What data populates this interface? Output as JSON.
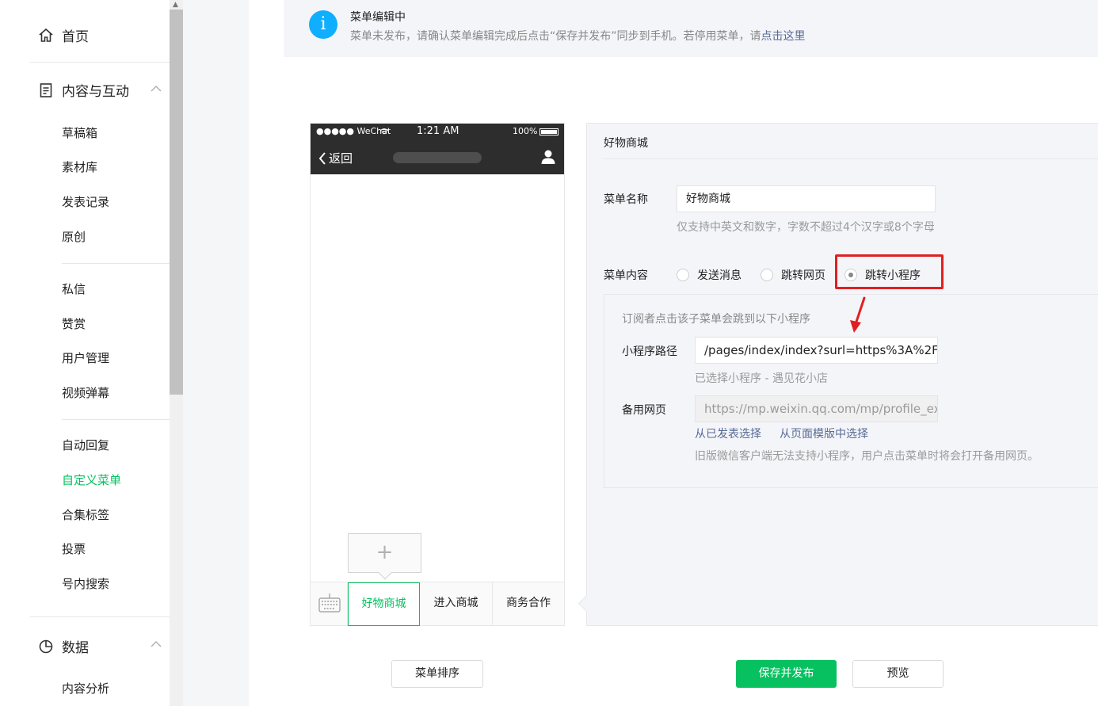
{
  "sidebar": {
    "home": "首页",
    "content_section": "内容与互动",
    "items_group1": [
      "草稿箱",
      "素材库",
      "发表记录",
      "原创"
    ],
    "items_group2": [
      "私信",
      "赞赏",
      "用户管理",
      "视频弹幕"
    ],
    "items_group3": [
      "自动回复",
      "自定义菜单",
      "合集标签",
      "投票",
      "号内搜索"
    ],
    "active_item": "自定义菜单",
    "data_section": "数据",
    "items_group4": [
      "内容分析"
    ]
  },
  "notice": {
    "title": "菜单编辑中",
    "desc": "菜单未发布，请确认菜单编辑完成后点击“保存并发布”同步到手机。若停用菜单，请",
    "link": "点击这里"
  },
  "phone": {
    "carrier": "●●●●● WeChat",
    "time": "1:21 AM",
    "battery": "100%",
    "back_label": "返回",
    "add_symbol": "+",
    "menu_tabs": [
      "好物商城",
      "进入商城",
      "商务合作"
    ],
    "active_tab": "好物商城"
  },
  "editor": {
    "title": "好物商城",
    "name_label": "菜单名称",
    "name_value": "好物商城",
    "name_hint": "仅支持中英文和数字，字数不超过4个汉字或8个字母",
    "content_label": "菜单内容",
    "options": [
      "发送消息",
      "跳转网页",
      "跳转小程序"
    ],
    "selected_option": "跳转小程序",
    "content_desc": "订阅者点击该子菜单会跳到以下小程序",
    "path_label": "小程序路径",
    "path_value": "/pages/index/index?surl=https%3A%2F",
    "selected_app": "已选择小程序 - 遇见花小店",
    "backup_label": "备用网页",
    "backup_value": "https://mp.weixin.qq.com/mp/profile_ext",
    "link_published": "从已发表选择",
    "link_template": "从页面模版中选择",
    "backup_hint": "旧版微信客户端无法支持小程序，用户点击菜单时将会打开备用网页。"
  },
  "buttons": {
    "sort": "菜单排序",
    "save": "保存并发布",
    "preview": "预览"
  },
  "colors": {
    "accent": "#07c160",
    "link": "#576b95",
    "info": "#10aeff",
    "highlight": "#e02020"
  }
}
